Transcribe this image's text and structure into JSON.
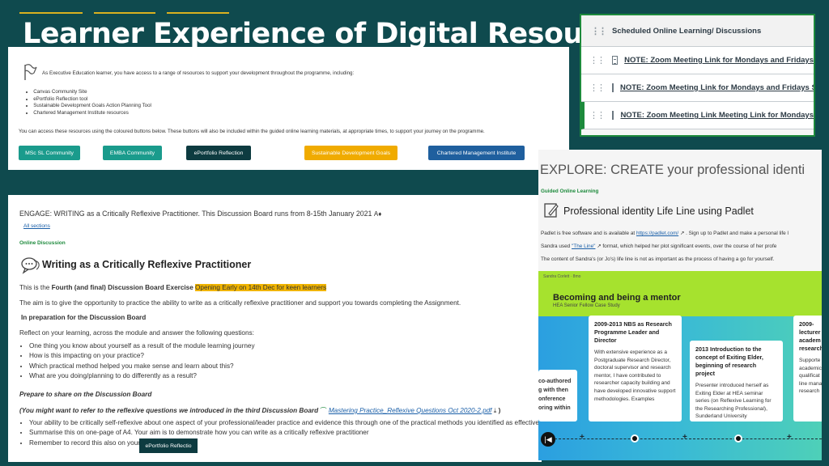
{
  "title": "Learner Experience of Digital Resources",
  "resources_panel": {
    "intro": "As Executive Education learner, you have access to a range of resources to support your development throughout the programme, including:",
    "items": [
      "Canvas Community Site",
      "ePortfolio Reflection tool",
      "Sustainable Development Goals Action Planning Tool",
      "Chartered Management Institute resources"
    ],
    "access_text": "You can access these resources using the coloured buttons below. These buttons will also be included within the guided online learning materials, at appropriate times, to support your journey on the programme.",
    "buttons": [
      {
        "label": "MSc SL Community",
        "color": "#1a9b8c"
      },
      {
        "label": "EMBA Community",
        "color": "#1a9b8c"
      },
      {
        "label": "ePortfolio Reflection",
        "color": "#0d3b40"
      },
      {
        "label": "Sustainable Development Goals",
        "color": "#f0ab00"
      },
      {
        "label": "Chartered Management Institute",
        "color": "#1f5f9e"
      }
    ]
  },
  "modules_panel": {
    "header": "Scheduled Online Learning/ Discussions",
    "items": [
      "NOTE: Zoom Meeting Link for Mondays and Fridays",
      "NOTE: Zoom Meeting Link for Mondays and Fridays S",
      "NOTE: Zoom Meeting Link Meeting Link for Mondays"
    ]
  },
  "discussion_panel": {
    "heading": "ENGAGE: WRITING as a Critically Reflexive Practitioner. This Discussion Board runs from 8-15th January 2021",
    "all_sections": "All sections",
    "category": "Online Discussion",
    "title": "Writing as a Critically Reflexive Practitioner",
    "exercise_prefix": "This is the ",
    "exercise_bold": "Fourth (and final) Discussion Board Exercise",
    "exercise_highlight": "Opening Early on 14th Dec for keen learners",
    "aim": "The aim is to give the opportunity to practice the ability to write as a critically reflexive practitioner and support you towards completing the Assignment.",
    "prep_heading": "In preparation for the Discussion Board",
    "reflect": "Reflect on your learning, across the module and answer the following questions:",
    "questions": [
      "One thing you know about yourself as a result of the module learning journey",
      "How is this impacting on your practice?",
      "Which practical method helped you make sense and learn about this?",
      "What are you doing/planning to do differently as a result?"
    ],
    "prepare_heading": "Prepare to share on the Discussion Board",
    "refer": "(You might want to refer to the reflexive questions we introduced in the third Discussion Board",
    "file_link": "Mastering Practice_Reflexive Questions Oct 2020-2.pdf",
    "tasks": [
      "Your ability to be critically self-reflexive about one aspect of your professional/leader practice and evidence this through one of the practical methods you identified as effective",
      "Summarise this on one-page of A4. Your aim is to demonstrate how you can write as a critically reflexive practitioner",
      "Remember to record this also on your"
    ],
    "eportfolio_button": "ePortfolio Reflectio"
  },
  "explore_panel": {
    "title": "EXPLORE: CREATE your professional identi",
    "category": "Guided Online Learning",
    "heading": "Professional identity Life Line using Padlet",
    "line1_prefix": "Padlet is free software and is available at",
    "padlet_link": "https://padlet.com/",
    "line1_suffix": ". Sign up to Padlet and make a personal life l",
    "line2_prefix": "Sandra used",
    "timeline_link": "\"The Line\"",
    "line2_suffix": "format, which helped her plot significant events, over the course of her profe",
    "line3": "The content of Sandra's (or Jo's) life line is not as important as the process of having a go for yourself.",
    "padlet_author": "Sandra Corlett · 8mo",
    "padlet_title": "Becoming and being a mentor",
    "padlet_subtitle": "HEA Senior Fellow Case Study",
    "cards": [
      {
        "title": "",
        "body": "co-authored\ng with then\nonference\noring within"
      },
      {
        "title": "2009-2013 NBS as Research Programme Leader and Director",
        "body": "With extensive experience as a Postgraduate Research Director, doctoral supervisor and research mentor, I have contributed to researcher capacity building and have developed innovative support methodologies. Examples"
      },
      {
        "title": "2013 Introduction to the concept of Exiting Elder, beginning of research project",
        "body": "Presenter introduced herself as Exiting Elder at HEA seminar series (on Reflexive Learning for the Researching Professional), Sunderland University"
      },
      {
        "title": "2009-\nlecturer\nacadem\nresearch",
        "body": "Supporte\nacademic\nqualificat\nline mana\nresearch"
      }
    ]
  }
}
